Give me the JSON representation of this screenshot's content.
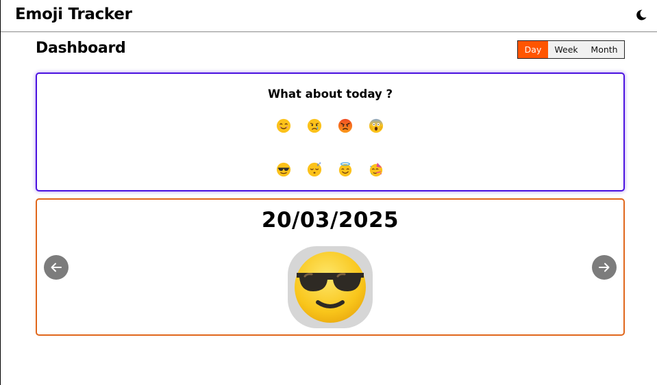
{
  "app": {
    "title": "Emoji Tracker",
    "theme_icon": "moon-icon"
  },
  "dashboard": {
    "title": "Dashboard",
    "periods": [
      {
        "label": "Day",
        "active": true
      },
      {
        "label": "Week",
        "active": false
      },
      {
        "label": "Month",
        "active": false
      }
    ]
  },
  "mood_picker": {
    "question": "What about today ?",
    "emojis": [
      {
        "name": "smiling-face-icon"
      },
      {
        "name": "crying-face-icon"
      },
      {
        "name": "angry-face-icon"
      },
      {
        "name": "screaming-face-icon"
      },
      {
        "name": "sunglasses-face-icon"
      },
      {
        "name": "sleeping-face-icon"
      },
      {
        "name": "halo-face-icon"
      },
      {
        "name": "party-face-icon"
      }
    ]
  },
  "day_view": {
    "date": "20/03/2025",
    "emoji": "sunglasses-face-icon",
    "prev_icon": "arrow-left-icon",
    "next_icon": "arrow-right-icon"
  },
  "colors": {
    "accent": "#ff5500",
    "mood_card_border": "#4b12e0",
    "day_card_border": "#e0661a",
    "nav_button": "#7c7c7c"
  }
}
